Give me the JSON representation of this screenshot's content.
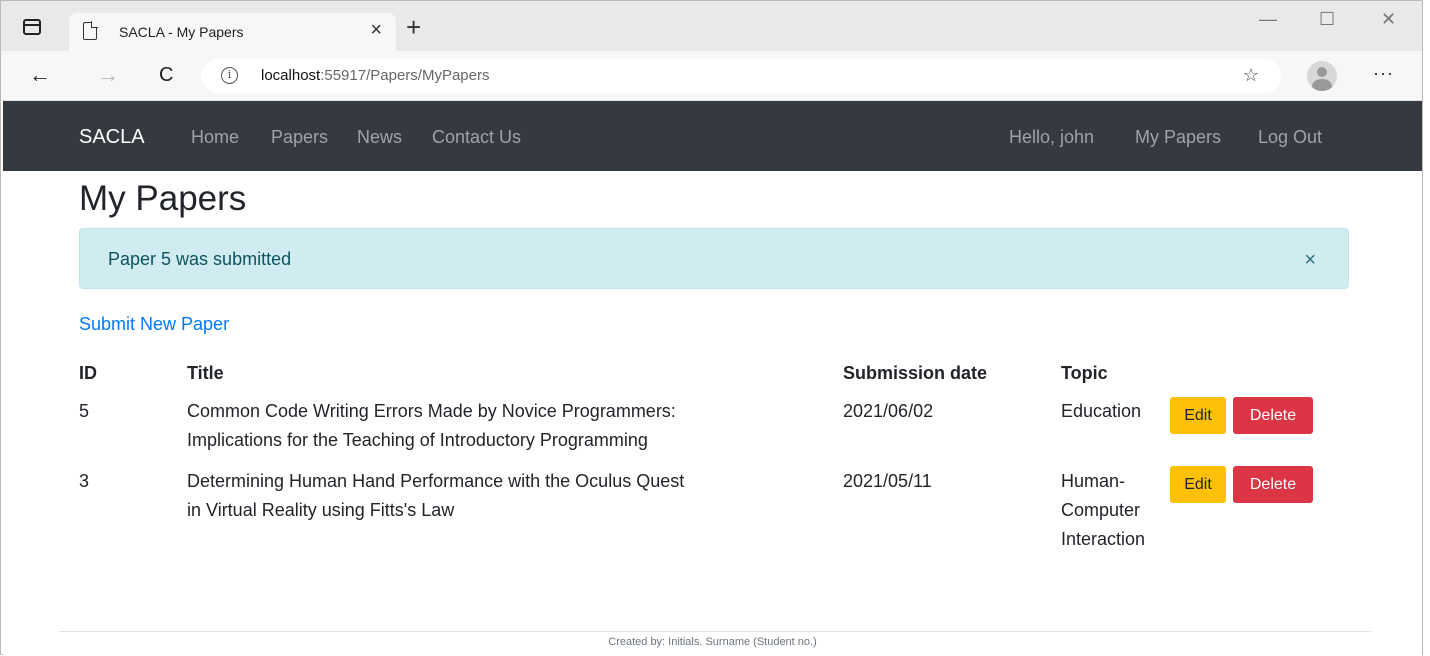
{
  "browser": {
    "tab_title": "SACLA - My Papers",
    "tab_close": "×",
    "new_tab": "+",
    "url_host": "localhost",
    "url_path": ":55917/Papers/MyPapers",
    "info_glyph": "i",
    "fav_glyph": "☆",
    "more_glyph": "···",
    "back_glyph": "←",
    "forward_glyph": "→",
    "reload_glyph": "C",
    "minimize_glyph": "—",
    "maximize_glyph": "☐",
    "close_glyph": "✕"
  },
  "navbar": {
    "brand": "SACLA",
    "links": [
      "Home",
      "Papers",
      "News",
      "Contact Us"
    ],
    "greeting": "Hello, john",
    "my_papers": "My Papers",
    "logout": "Log Out"
  },
  "main": {
    "title": "My Papers",
    "alert": {
      "text": "Paper 5 was submitted",
      "close": "×",
      "color": "#d1ecf1"
    },
    "submit_link": "Submit New Paper",
    "table": {
      "headers": [
        "ID",
        "Title",
        "Submission date",
        "Topic"
      ],
      "rows": [
        {
          "id": "5",
          "title_lines": [
            "Common Code Writing Errors Made by Novice Programmers:",
            "Implications for the Teaching of Introductory Programming"
          ],
          "date": "2021/06/02",
          "topic_lines": [
            "Education"
          ],
          "edit": "Edit",
          "delete": "Delete"
        },
        {
          "id": "3",
          "title_lines": [
            "Determining Human Hand Performance with the Oculus Quest",
            "in Virtual Reality using Fitts's Law"
          ],
          "date": "2021/05/11",
          "topic_lines": [
            "Human-",
            "Computer",
            "Interaction"
          ],
          "edit": "Edit",
          "delete": "Delete"
        }
      ]
    }
  },
  "footer": {
    "text": "Created by: Initials. Surname (Student no.)"
  },
  "colors": {
    "navbar": "#343a40",
    "edit": "#ffc107",
    "delete": "#dc3545",
    "link": "#007bff"
  }
}
